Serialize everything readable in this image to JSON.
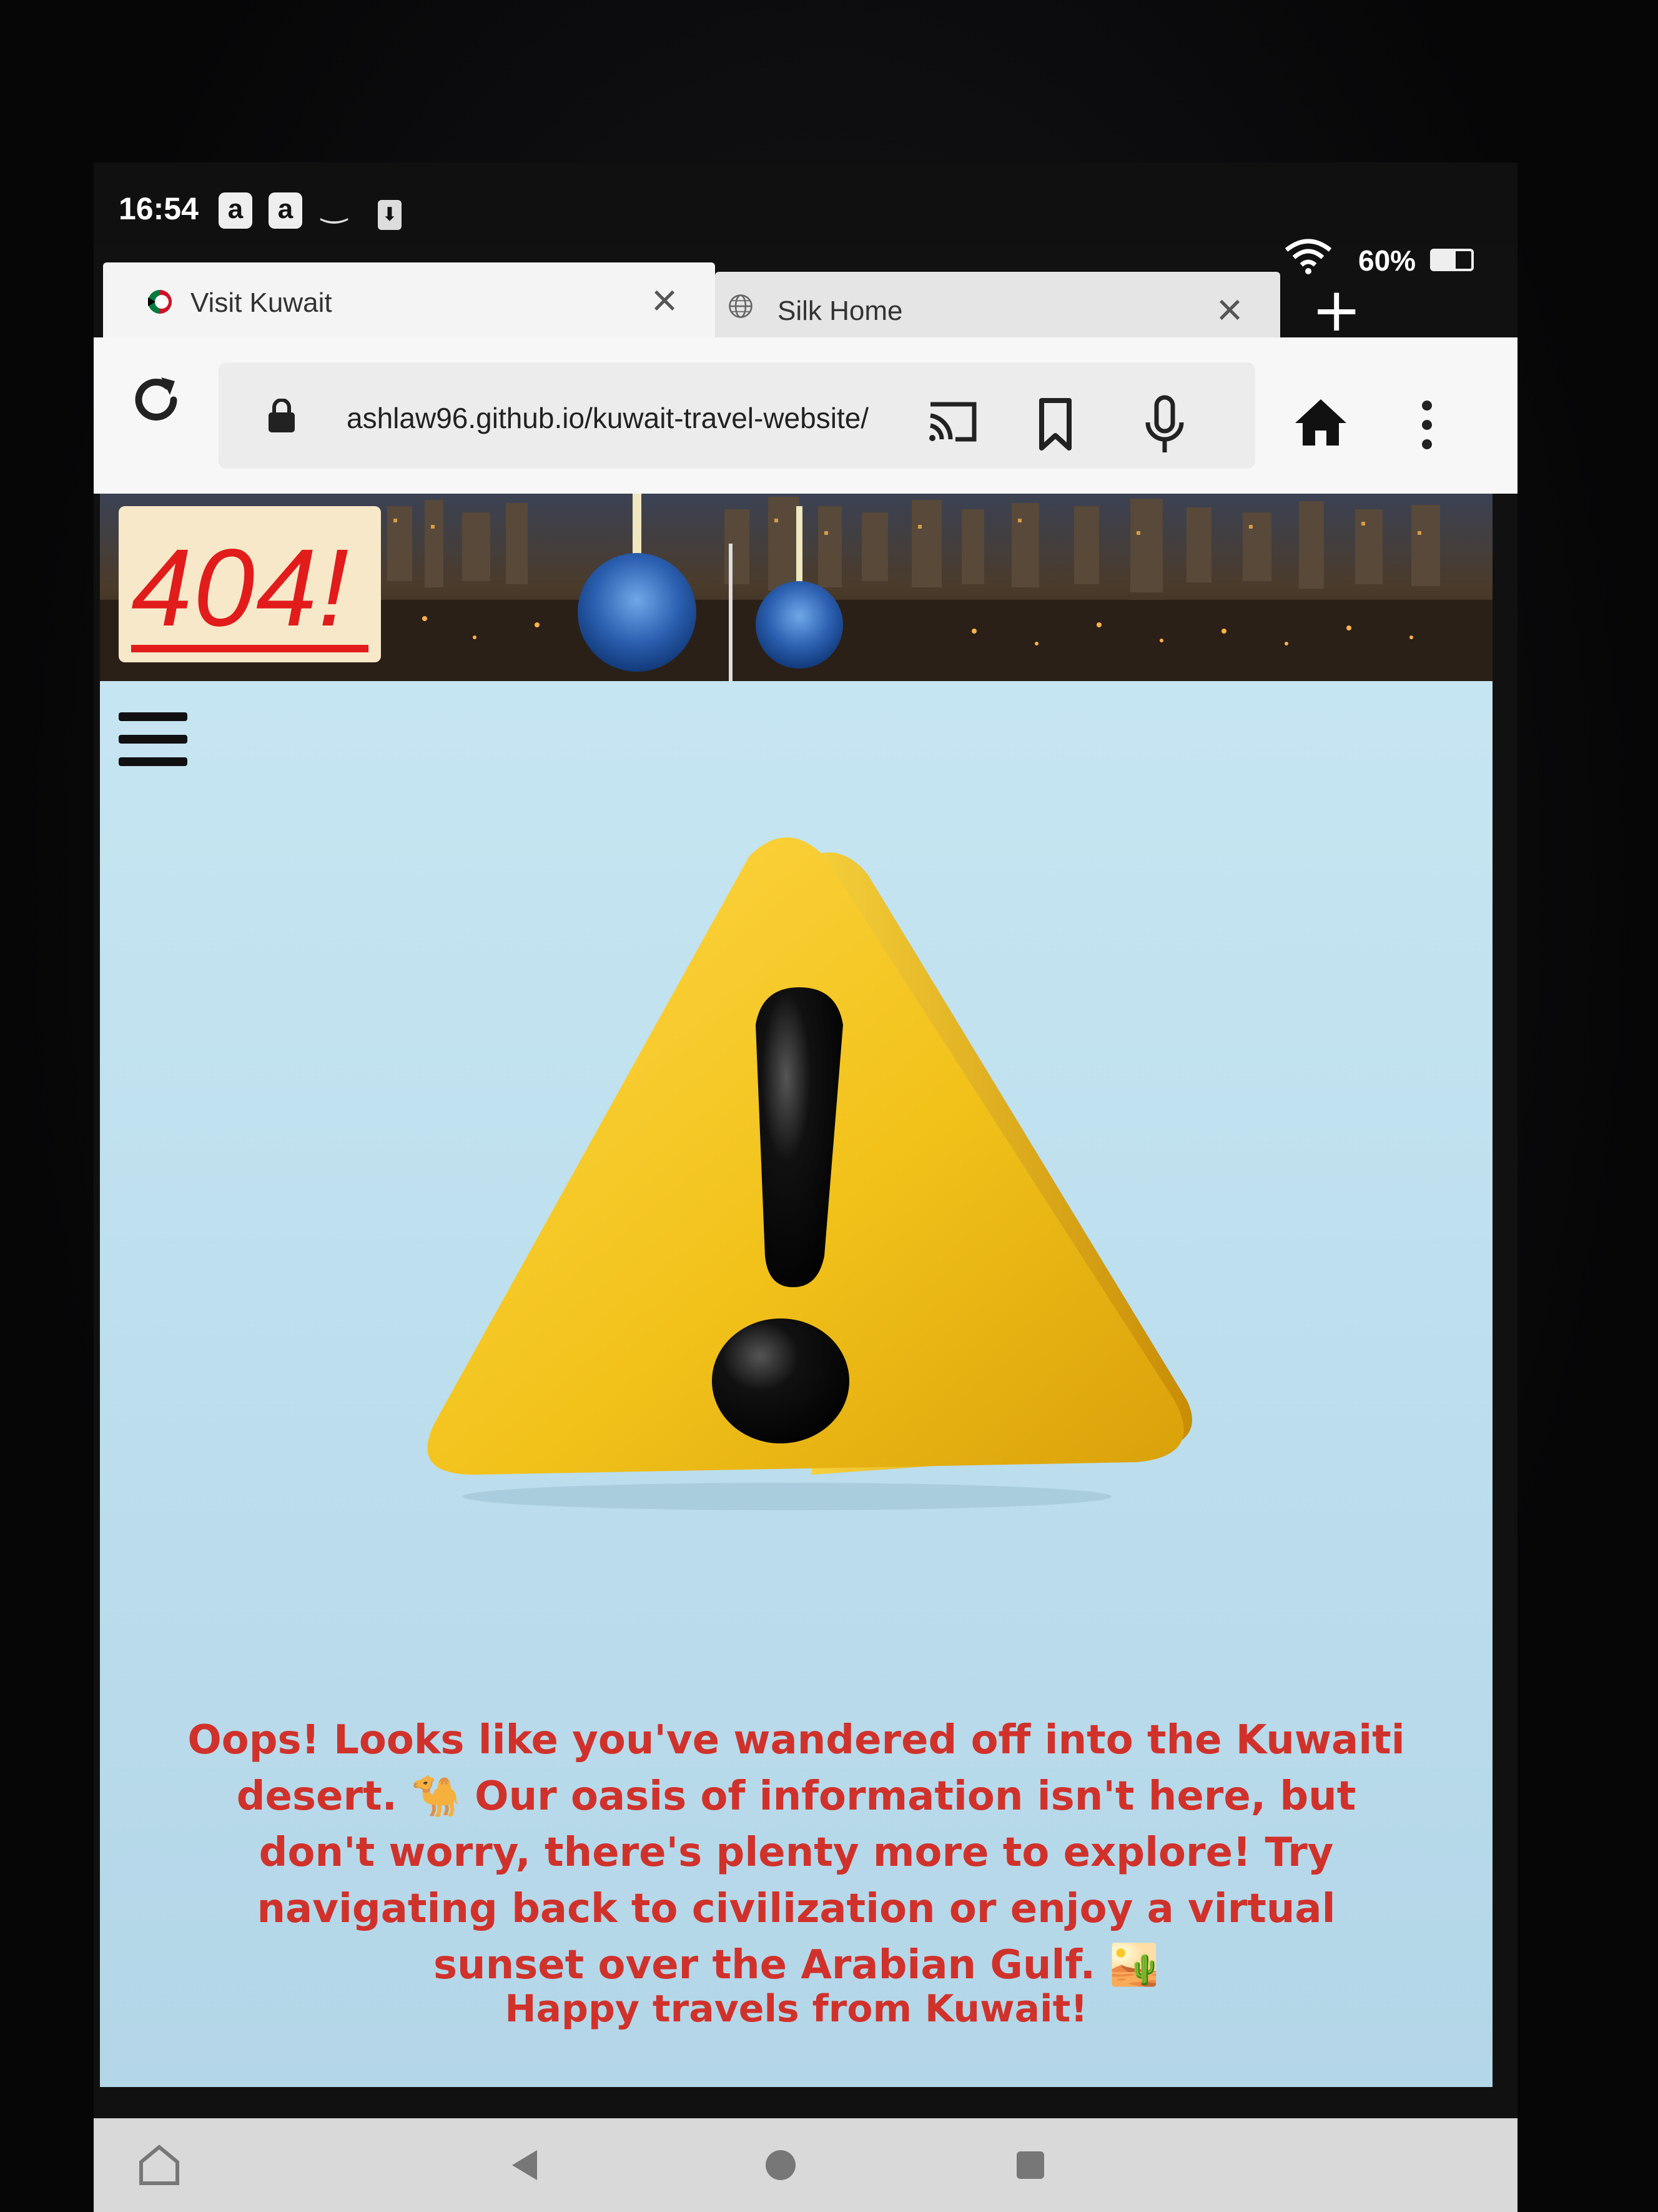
{
  "status_bar": {
    "time": "16:54",
    "notification_icons": [
      "a",
      "a"
    ],
    "battery_percent": "60%",
    "battery_level": 0.6
  },
  "tabs": [
    {
      "label": "Visit Kuwait",
      "active": true
    },
    {
      "label": "Silk Home",
      "active": false
    }
  ],
  "toolbar": {
    "url": "ashlaw96.github.io/kuwait-travel-website/"
  },
  "page": {
    "error_code": "404!",
    "message": "Oops! Looks like you've wandered off into the Kuwaiti desert. 🐪 Our oasis of information isn't here, but don't worry, there's plenty more to explore! Try navigating back to civilization or enjoy a virtual sunset over the Arabian Gulf. 🏜️",
    "signoff": "Happy travels from Kuwait!"
  },
  "colors": {
    "message_red": "#d0322b",
    "badge_red": "#e21b1b",
    "warning_yellow": "#f2c21a",
    "page_bg": "#c9e7f3"
  }
}
